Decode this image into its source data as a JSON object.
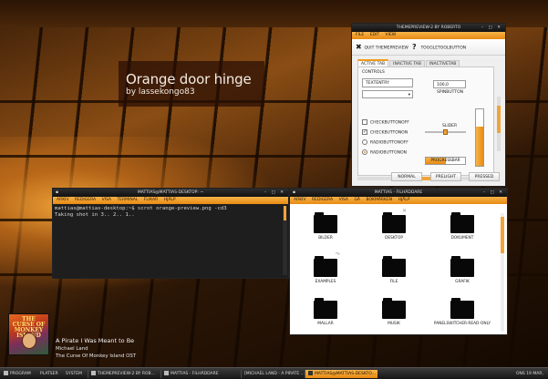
{
  "wallpaper": {
    "title": "Orange door hinge",
    "subtitle": "by lassekongo83"
  },
  "colors": {
    "accent": "#f29a1a",
    "menubar_top": "#f7b44a",
    "menubar_bottom": "#e88a13"
  },
  "theme_preview": {
    "window_title": "THEMEPREVIEW-2 BY ROBERTO",
    "menu": [
      "FILE",
      "EDIT",
      "VIEW"
    ],
    "toolbar": {
      "quit_label": "QUIT THEMEPREVIEW",
      "quit_icon": "close-icon",
      "toggle_label": "TOGGLETOOLBUTTON",
      "toggle_icon": "question-icon"
    },
    "tabs": [
      "ACTIVE TAB",
      "INACTIVE TAB",
      "INACTIVETAB"
    ],
    "controls_label": "CONTROLS",
    "textentry_value": "TEXTENTRY",
    "spin_value": "100,0",
    "spinbutton_label": "SPINBUTTON",
    "slider_label": "SLIDER",
    "checkboxes": [
      {
        "label": "CHECKBUTTONOFF",
        "checked": false
      },
      {
        "label": "CHECKBUTTONON",
        "checked": true
      }
    ],
    "radios": [
      {
        "label": "RADIOBUTTONOFF",
        "checked": false
      },
      {
        "label": "RADIOBUTTONON",
        "checked": true
      }
    ],
    "progress_label": "PROGRESSBAR",
    "progress_value": 0.5,
    "vslider_value": 0.7,
    "buttons": [
      "NORMAL",
      "PRELIGHT",
      "PRESSED"
    ]
  },
  "terminal": {
    "window_title": "MATTIAS@MATTIAS-DESKTOP: ~",
    "menu": [
      "ARKIV",
      "REDIGERA",
      "VISA",
      "TERMINAL",
      "FLIKAR",
      "HJÄLP"
    ],
    "lines": [
      "mattias@mattias-desktop:~$ scrot orange-preview.png -cd3",
      "Taking shot in 3.. 2.. 1.."
    ]
  },
  "file_manager": {
    "window_title": "MATTIAS - FILHÄDDARE",
    "menu": [
      "ARKIV",
      "REDIGERA",
      "VISA",
      "GÅ",
      "BOKMÄRKEN",
      "HJÄLP"
    ],
    "items": [
      {
        "name": "BILDER",
        "emblem": ""
      },
      {
        "name": "DESKTOP",
        "emblem": "lock-icon"
      },
      {
        "name": "DOKUMENT",
        "emblem": ""
      },
      {
        "name": "EXAMPLES",
        "emblem": "link-icon"
      },
      {
        "name": "FILE",
        "emblem": ""
      },
      {
        "name": "GRAFIK",
        "emblem": ""
      },
      {
        "name": "MALLAR",
        "emblem": ""
      },
      {
        "name": "MUSIK",
        "emblem": ""
      },
      {
        "name": "PANELSWITCHER-READ-ONLY",
        "emblem": ""
      }
    ]
  },
  "now_playing": {
    "cover_text": "THE CURSE OF MONKEY ISLAND",
    "title": "A Pirate I Was Meant to Be",
    "artist": "Michael Land",
    "album": "The Curse Of Monkey Island OST"
  },
  "taskbar": {
    "menus": [
      "PROGRAM",
      "PLATSER",
      "SYSTEM"
    ],
    "tasks": [
      {
        "label": "THEMEPREVIEW-2 BY ROB...",
        "active": false
      },
      {
        "label": "MATTIAS - FILHÄDDARE",
        "active": false
      },
      {
        "label": "[MICHAEL LAND - A PIRATE ...",
        "active": false
      },
      {
        "label": "MATTIAS@MATTIAS-DESKTO...",
        "active": true
      }
    ],
    "clock": "ONS 19 MAR,"
  }
}
